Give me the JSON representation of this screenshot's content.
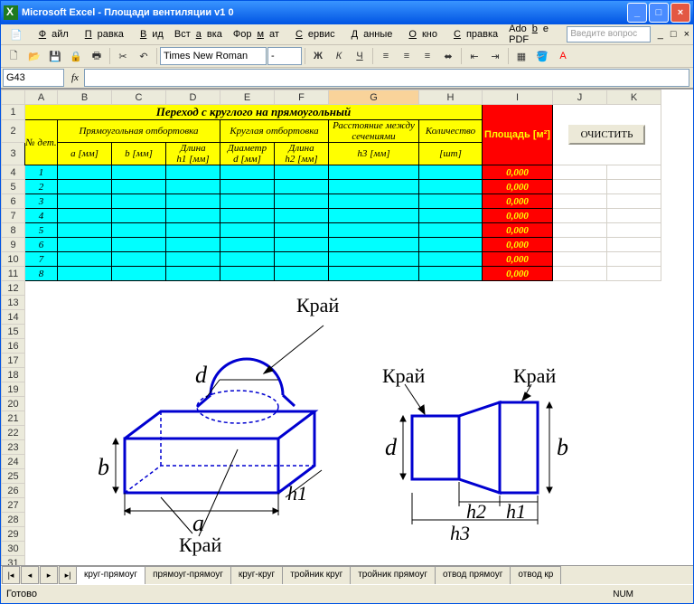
{
  "window": {
    "title": "Microsoft Excel - Площади вентиляции  v1 0"
  },
  "menu": {
    "file": "Файл",
    "edit": "Правка",
    "view": "Вид",
    "insert": "Вставка",
    "format": "Формат",
    "tools": "Сервис",
    "data": "Данные",
    "window": "Окно",
    "help": "Справка",
    "pdf": "Adobe PDF",
    "askbox": "Введите вопрос"
  },
  "toolbar": {
    "font": "Times New Roman",
    "size": "-"
  },
  "fxbar": {
    "namebox": "G43"
  },
  "table": {
    "title": "Переход с круглого на прямоугольный",
    "headQ": "Расстояние между сечениями",
    "headK": "Количество",
    "headArea": "Площадь [м²]",
    "headNo": "№ дет.",
    "groupRect": "Прямоугольная отбортовка",
    "groupRound": "Круглая отбортовка",
    "colA": "a [мм]",
    "colB": "b [мм]",
    "colH1": "Длина\nh1 [мм]",
    "colD": "Диаметр\nd [мм]",
    "colH2": "Длина\nh2 [мм]",
    "colH3": "h3 [мм]",
    "colSht": "[шт]",
    "rows": [
      {
        "n": "1",
        "v": "0,000"
      },
      {
        "n": "2",
        "v": "0,000"
      },
      {
        "n": "3",
        "v": "0,000"
      },
      {
        "n": "4",
        "v": "0,000"
      },
      {
        "n": "5",
        "v": "0,000"
      },
      {
        "n": "6",
        "v": "0,000"
      },
      {
        "n": "7",
        "v": "0,000"
      },
      {
        "n": "8",
        "v": "0,000"
      }
    ],
    "clear_btn": "ОЧИСТИТЬ"
  },
  "diagram": {
    "edge": "Край",
    "d": "d",
    "b": "b",
    "a": "a",
    "h1": "h1",
    "h2": "h2",
    "h3": "h3"
  },
  "sheets": {
    "t1": "круг-прямоуг",
    "t2": "прямоуг-прямоуг",
    "t3": "круг-круг",
    "t4": "тройник круг",
    "t5": "тройник прямоуг",
    "t6": "отвод прямоуг",
    "t7": "отвод кр"
  },
  "status": {
    "ready": "Готово",
    "num": "NUM"
  }
}
